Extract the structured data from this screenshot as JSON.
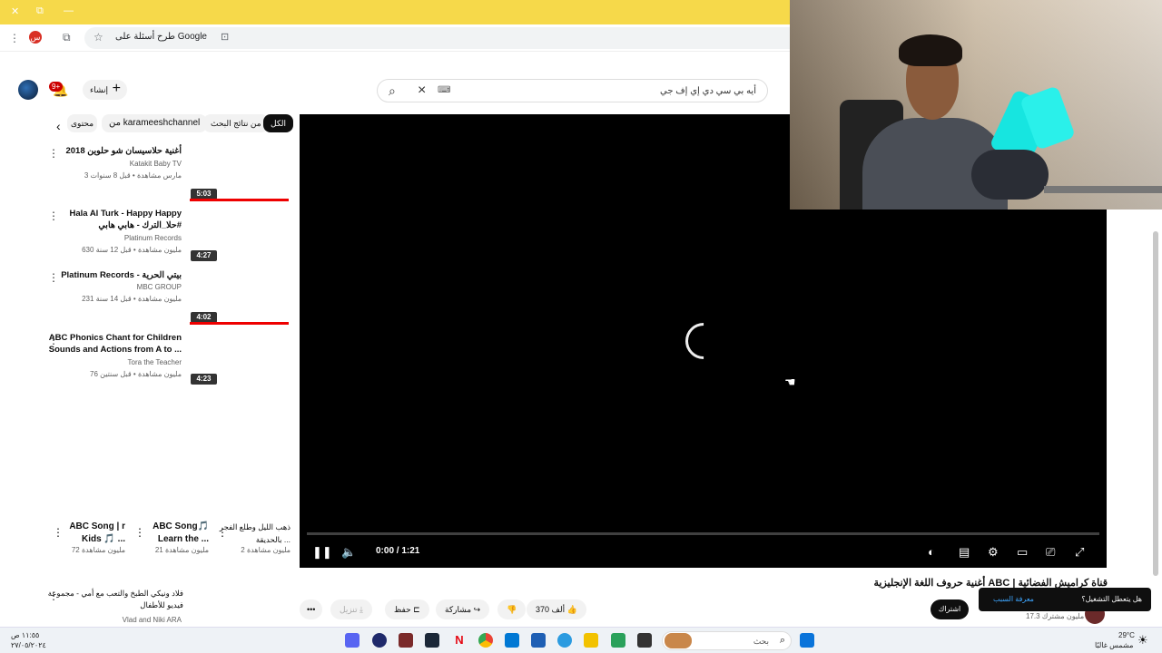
{
  "browser": {
    "address_text": "طرح أسئلة على Google",
    "profile_badge": "س",
    "window_controls": {
      "close": "✕",
      "restore": "⧉",
      "minimize": "—"
    }
  },
  "header": {
    "search_query": "أيه بي سي دي إي إف جي",
    "create_label": "إنشاء",
    "notifications_count": "9+"
  },
  "chips": [
    "الكل",
    "من نتائج البحث",
    "من karameeshchannel",
    "محتوى"
  ],
  "related": [
    {
      "title": "أغنية حلاسيسان شو حلوين 2018",
      "channel": "Katakit Baby TV",
      "meta": "3 مارس مشاهدة • قبل 8 سنوات",
      "duration": "5:03",
      "progress": 1.0
    },
    {
      "title": "Hala Al Turk - Happy Happy حلا_الترك - هابي هابي#",
      "channel": "Platinum Records",
      "meta": "630 مليون مشاهدة • قبل 12 سنة",
      "duration": "4:27",
      "progress": 0
    },
    {
      "title": "Platinum Records - بيتي الحرية",
      "channel": "MBC GROUP",
      "meta": "231 مليون مشاهدة • قبل 14 سنة",
      "duration": "4:02",
      "progress": 1.0
    },
    {
      "title": "ABC Phonics Chant for Children Sounds and Actions from A to ...",
      "channel": "Tora the Teacher",
      "meta": "76 مليون مشاهدة • قبل سنتين",
      "duration": "4:23",
      "progress": 0
    }
  ],
  "shelf": [
    {
      "title": "ABC Song | r Kids 🎵 ...",
      "meta": "72 مليون مشاهدة"
    },
    {
      "title": "ABC Song🎵 Learn the ...",
      "meta": "21 مليون مشاهدة"
    },
    {
      "title": "ذهب الليل وطلع الفجر بالحديقة ...",
      "meta": "2 مليون مشاهدة"
    }
  ],
  "last_item": {
    "title": "فلاد ونيكي الطبخ والتعب مع أمي - مجموعة فيديو للأطفال",
    "channel": "Vlad and Niki ARA"
  },
  "player": {
    "time": "0:00 / 1:21",
    "state": "loading",
    "progress": 0
  },
  "video": {
    "title": "أغنية حروف اللغة الإنجليزية ABC | قناة كراميش الفضائية",
    "like_count": "370 ألف",
    "share_label": "مشاركة",
    "save_label": "حفظ",
    "download_label": "تنزيل",
    "subscribe_label": "اشتراك",
    "channel_meta": "17.3 مليون مشترك"
  },
  "toast": {
    "message": "هل يتعطل التشغيل؟",
    "link": "معرفة السبب"
  },
  "taskbar": {
    "search_placeholder": "بحث",
    "weather_temp": "29°C",
    "weather_desc": "مشمس غالبًا",
    "clock_time": "١١:٥٥ ص",
    "clock_date": "٢٧/٠٥/٢٠٢٤"
  },
  "colors": {
    "titlebar": "#f6d94a",
    "accent_red": "#ee0000",
    "link_blue": "#3ea6ff",
    "webcam_lamp": "#17e5e0"
  }
}
